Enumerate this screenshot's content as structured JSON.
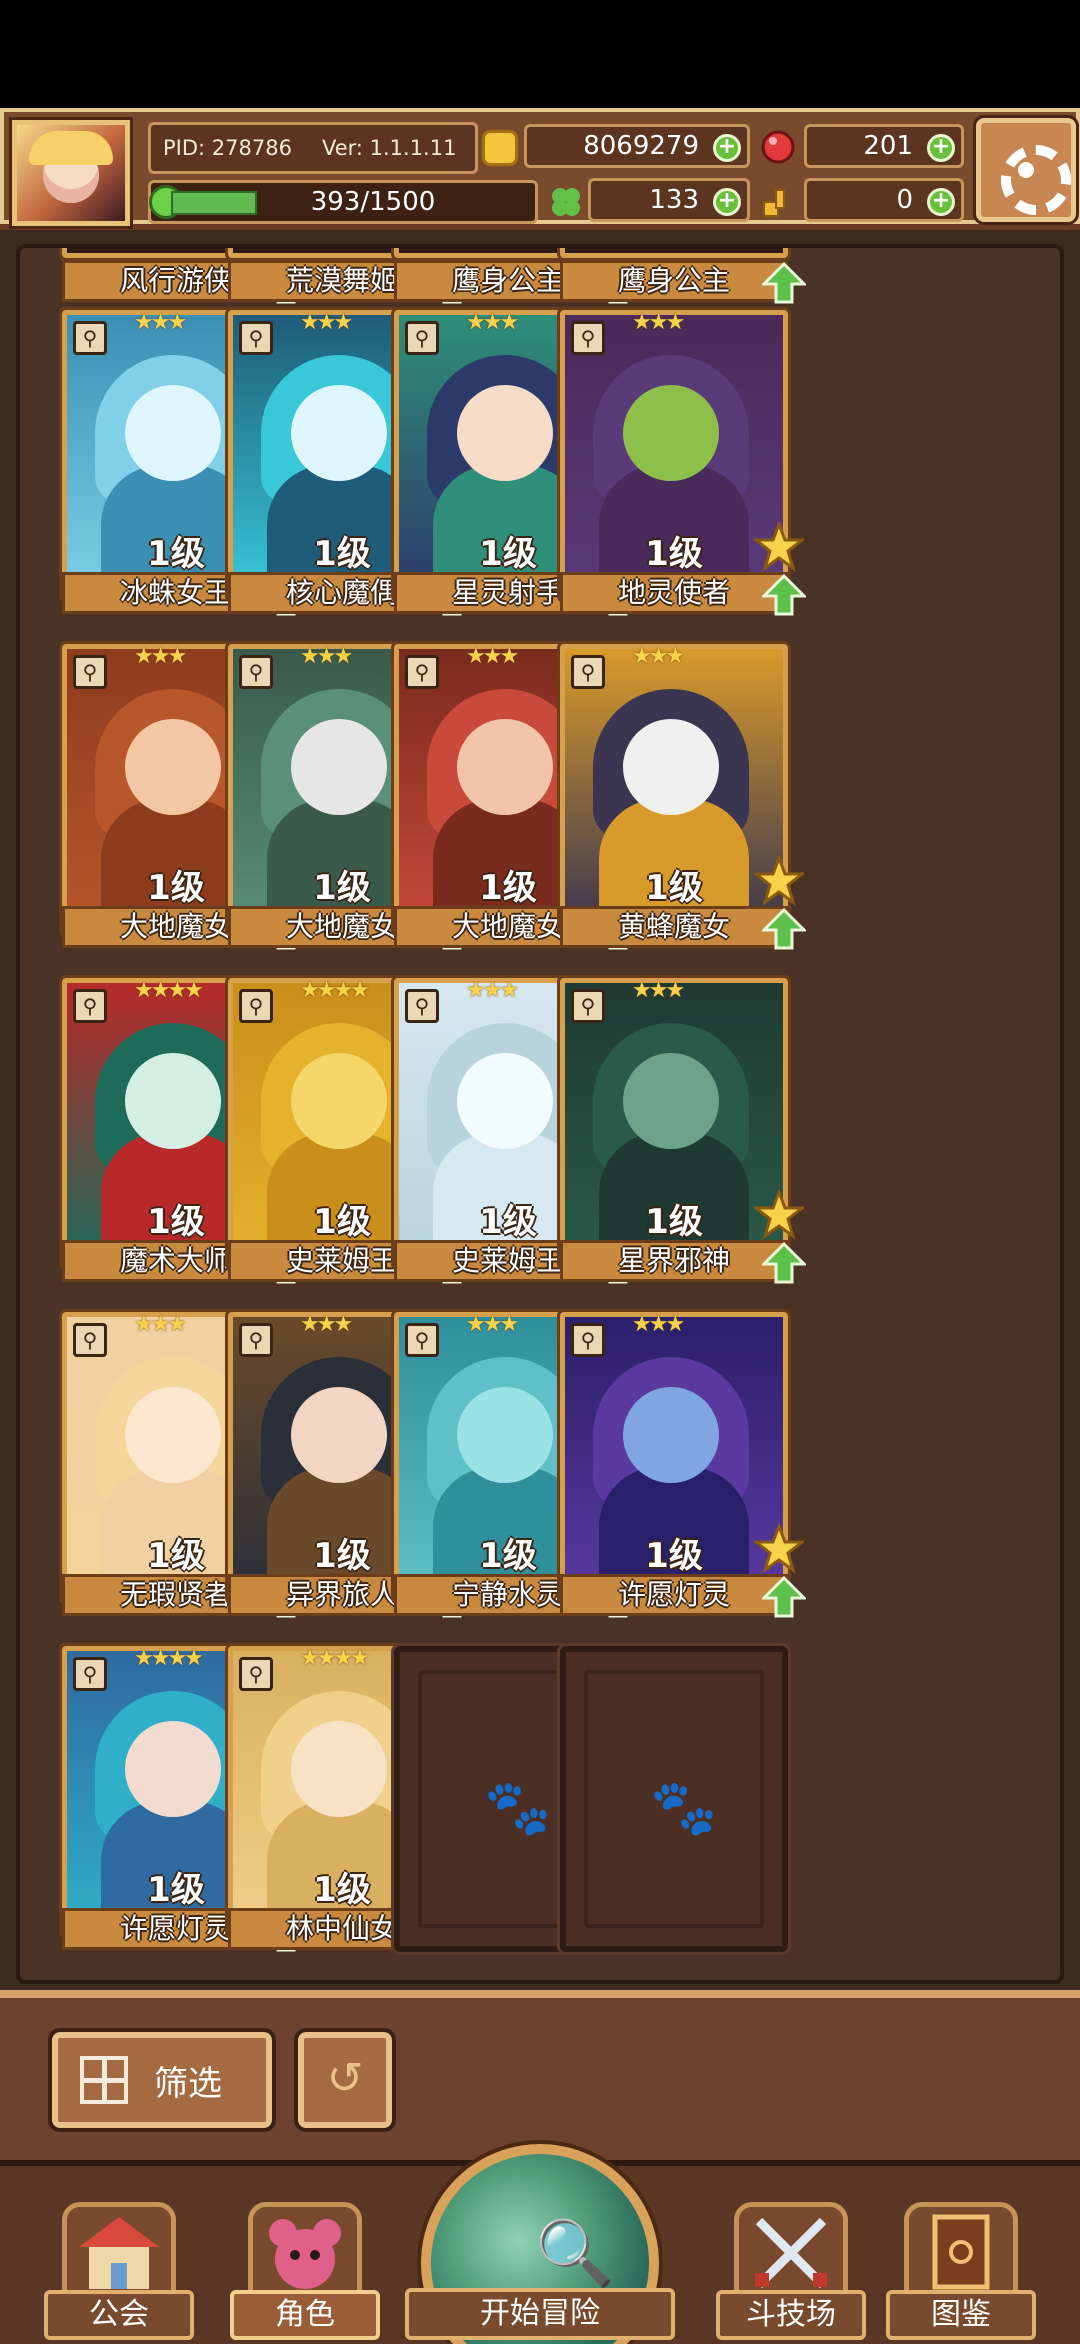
{
  "hud": {
    "pid": "PID: 278786",
    "version": "Ver: 1.1.1.11",
    "gold": "8069279",
    "gems": "201",
    "xp_text": "393/1500",
    "xp_progress": 0.262,
    "clover": "133",
    "keys": "0"
  },
  "top_row_names": [
    "风行游侠",
    "荒漠舞姬",
    "鹰身公主",
    "鹰身公主"
  ],
  "characters": [
    {
      "name": "冰蛛女王",
      "level": "1级",
      "stars": "★★★"
    },
    {
      "name": "核心魔偶",
      "level": "1级",
      "stars": "★★★"
    },
    {
      "name": "星灵射手",
      "level": "1级",
      "stars": "★★★"
    },
    {
      "name": "地灵使者",
      "level": "1级",
      "stars": "★★★"
    },
    {
      "name": "大地魔女",
      "level": "1级",
      "stars": "★★★"
    },
    {
      "name": "大地魔女",
      "level": "1级",
      "stars": "★★★"
    },
    {
      "name": "大地魔女",
      "level": "1级",
      "stars": "★★★"
    },
    {
      "name": "黄蜂魔女",
      "level": "1级",
      "stars": "★★★"
    },
    {
      "name": "魔术大师",
      "level": "1级",
      "stars": "★★★★"
    },
    {
      "name": "史莱姆王",
      "level": "1级",
      "stars": "★★★★"
    },
    {
      "name": "史莱姆王",
      "level": "1级",
      "stars": "★★★"
    },
    {
      "name": "星界邪神",
      "level": "1级",
      "stars": "★★★"
    },
    {
      "name": "无瑕贤者",
      "level": "1级",
      "stars": "★★★"
    },
    {
      "name": "异界旅人",
      "level": "1级",
      "stars": "★★★"
    },
    {
      "name": "宁静水灵",
      "level": "1级",
      "stars": "★★★"
    },
    {
      "name": "许愿灯灵",
      "level": "1级",
      "stars": "★★★"
    },
    {
      "name": "许愿灯灵",
      "level": "1级",
      "stars": "★★★★"
    },
    {
      "name": "林中仙女",
      "level": "1级",
      "stars": "★★★★"
    }
  ],
  "toolbar": {
    "filter_label": "筛选"
  },
  "nav": {
    "guild": "公会",
    "character": "角色",
    "adventure": "开始冒险",
    "arena": "斗技场",
    "codex": "图鉴"
  },
  "colors": {
    "accent_green": "#69c03a",
    "frame_gold": "#d7a04c",
    "panel_brown": "#4a3226"
  }
}
